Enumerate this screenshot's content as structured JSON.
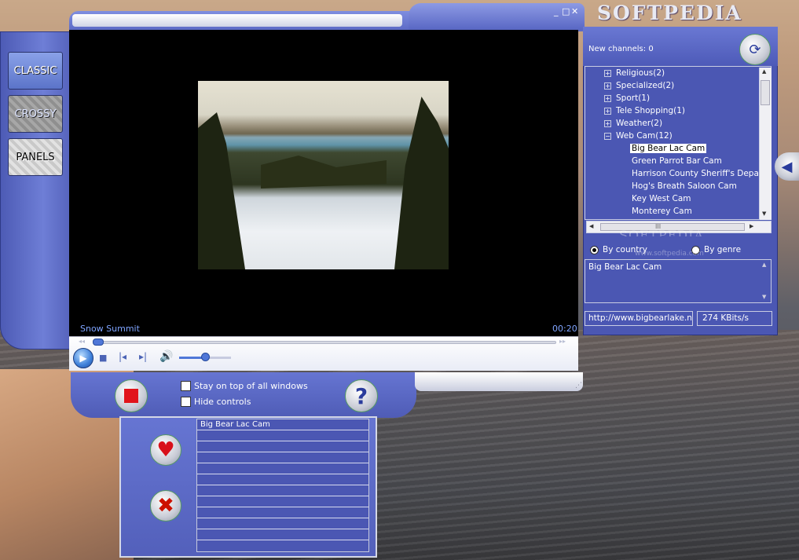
{
  "desktop": {
    "logo_text": "SOFTPEDIA"
  },
  "window_controls": {
    "minimize": "_",
    "maximize": "□",
    "close": "✕"
  },
  "skin_buttons": [
    {
      "label": "CLASSIC"
    },
    {
      "label": "CROSSY"
    },
    {
      "label": "PANELS"
    }
  ],
  "video": {
    "caption": "Snow Summit",
    "time": "00:20"
  },
  "controls": {
    "play_icon": "play-icon",
    "stop_icon": "stop-icon",
    "prev_icon": "previous-icon",
    "next_icon": "next-icon",
    "volume_icon": "speaker-icon",
    "seek_fraction": 0.01,
    "volume_fraction": 0.5
  },
  "options": {
    "stay_on_top": "Stay on top of all windows",
    "hide_controls": "Hide controls",
    "help_symbol": "?"
  },
  "favorites": {
    "items": [
      "Big Bear Lac Cam",
      "",
      "",
      "",
      "",
      "",
      "",
      "",
      "",
      "",
      ""
    ]
  },
  "channels": {
    "new_channels_label": "New channels: 0",
    "tree": [
      {
        "label": "Religious(2)",
        "expander": "+",
        "level": 0
      },
      {
        "label": "Specialized(2)",
        "expander": "+",
        "level": 0
      },
      {
        "label": "Sport(1)",
        "expander": "+",
        "level": 0
      },
      {
        "label": "Tele Shopping(1)",
        "expander": "+",
        "level": 0
      },
      {
        "label": "Weather(2)",
        "expander": "+",
        "level": 0
      },
      {
        "label": "Web Cam(12)",
        "expander": "−",
        "level": 0
      },
      {
        "label": "Big Bear Lac Cam",
        "expander": "",
        "level": 1,
        "selected": true
      },
      {
        "label": "Green Parrot Bar Cam",
        "expander": "",
        "level": 1
      },
      {
        "label": "Harrison County Sheriff's Departm",
        "expander": "",
        "level": 1
      },
      {
        "label": "Hog's Breath Saloon Cam",
        "expander": "",
        "level": 1
      },
      {
        "label": "Key West Cam",
        "expander": "",
        "level": 1
      },
      {
        "label": "Monterey Cam",
        "expander": "",
        "level": 1
      }
    ],
    "hscroll_grip": "III",
    "radio_by_country": "By country",
    "radio_by_genre": "By genre",
    "selected_channel_info": "Big Bear Lac Cam",
    "url": "http://www.bigbearlake.ne",
    "bitrate": "274 KBits/s",
    "watermark": "SOFTPEDIA",
    "watermark_url": "www.softpedia.com"
  },
  "colors": {
    "skin_blue": "#5562bb",
    "caption_blue": "#7fa4ff",
    "stop_red": "#e1141b"
  }
}
